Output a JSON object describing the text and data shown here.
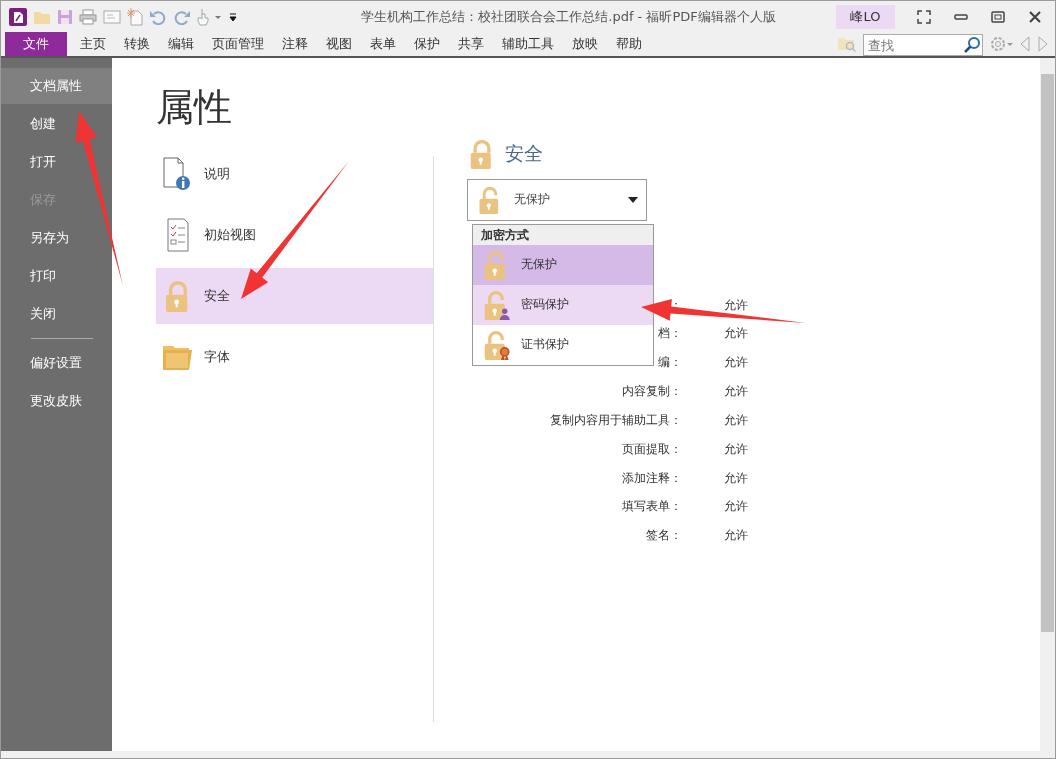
{
  "window": {
    "title": "学生机构工作总结：校社团联合会工作总结.pdf - 福昕PDF编辑器个人版",
    "user": "峰LO"
  },
  "ribbon_tabs": [
    {
      "label": "文件",
      "selected": true
    },
    {
      "label": "主页",
      "selected": false
    },
    {
      "label": "转换",
      "selected": false
    },
    {
      "label": "编辑",
      "selected": false
    },
    {
      "label": "页面管理",
      "selected": false
    },
    {
      "label": "注释",
      "selected": false
    },
    {
      "label": "视图",
      "selected": false
    },
    {
      "label": "表单",
      "selected": false
    },
    {
      "label": "保护",
      "selected": false
    },
    {
      "label": "共享",
      "selected": false
    },
    {
      "label": "辅助工具",
      "selected": false
    },
    {
      "label": "放映",
      "selected": false
    },
    {
      "label": "帮助",
      "selected": false
    }
  ],
  "search": {
    "placeholder": "查找"
  },
  "sidebar": {
    "groups": [
      [
        {
          "label": "文档属性",
          "selected": true,
          "disabled": false
        },
        {
          "label": "创建",
          "selected": false,
          "disabled": false
        },
        {
          "label": "打开",
          "selected": false,
          "disabled": false
        },
        {
          "label": "保存",
          "selected": false,
          "disabled": true
        },
        {
          "label": "另存为",
          "selected": false,
          "disabled": false
        },
        {
          "label": "打印",
          "selected": false,
          "disabled": false
        },
        {
          "label": "关闭",
          "selected": false,
          "disabled": false
        }
      ],
      [
        {
          "label": "偏好设置",
          "selected": false,
          "disabled": false
        },
        {
          "label": "更改皮肤",
          "selected": false,
          "disabled": false
        }
      ]
    ]
  },
  "page": {
    "heading": "属性",
    "categories": [
      {
        "label": "说明",
        "kind": "info",
        "selected": false
      },
      {
        "label": "初始视图",
        "kind": "checklist",
        "selected": false
      },
      {
        "label": "安全",
        "kind": "lock",
        "selected": true
      },
      {
        "label": "字体",
        "kind": "font",
        "selected": false
      }
    ]
  },
  "security": {
    "heading": "安全",
    "select_value": "无保护",
    "dropdown": {
      "header": "加密方式",
      "options": [
        {
          "label": "无保护",
          "kind": "none",
          "selected": true,
          "hovered": false
        },
        {
          "label": "密码保护",
          "kind": "password",
          "selected": false,
          "hovered": true
        },
        {
          "label": "证书保护",
          "kind": "certificate",
          "selected": false,
          "hovered": false
        }
      ]
    },
    "permissions": [
      {
        "label": "：",
        "value": "允许"
      },
      {
        "label": "档：",
        "value": "允许"
      },
      {
        "label": "编：",
        "value": "允许"
      },
      {
        "label": "内容复制：",
        "value": "允许"
      },
      {
        "label": "复制内容用于辅助工具：",
        "value": "允许"
      },
      {
        "label": "页面提取：",
        "value": "允许"
      },
      {
        "label": "添加注释：",
        "value": "允许"
      },
      {
        "label": "填写表单：",
        "value": "允许"
      },
      {
        "label": "签名：",
        "value": "允许"
      }
    ]
  }
}
